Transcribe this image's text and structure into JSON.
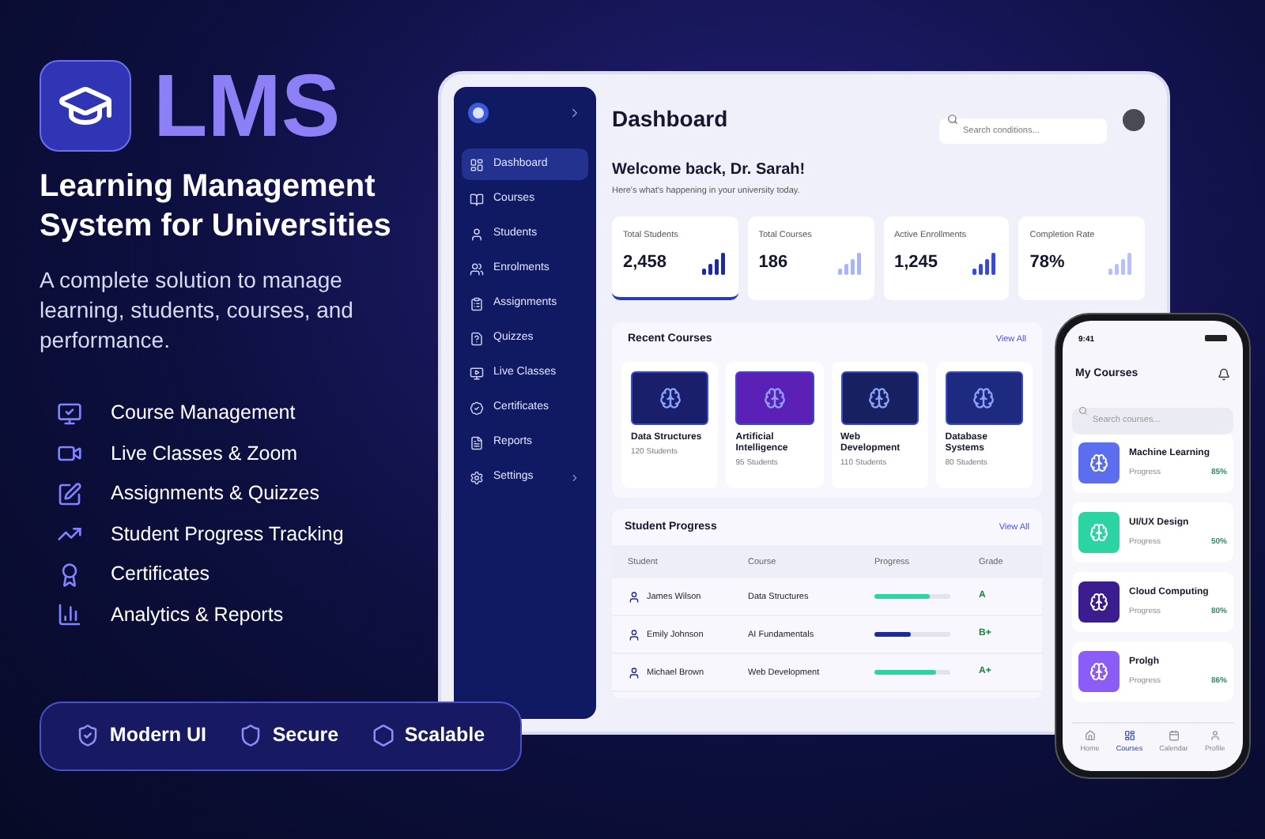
{
  "brand": {
    "logo_text": "LMS",
    "headline": "Learning Management System for Universities",
    "description": "A complete solution to manage learning, students, courses, and performance."
  },
  "features": [
    {
      "kind": "course",
      "label": "Course Management"
    },
    {
      "kind": "video",
      "label": "Live Classes & Zoom"
    },
    {
      "kind": "edit",
      "label": "Assignments & Quizzes"
    },
    {
      "kind": "progress",
      "label": "Student Progress Tracking"
    },
    {
      "kind": "certificate",
      "label": "Certificates"
    },
    {
      "kind": "analytics",
      "label": "Analytics & Reports"
    }
  ],
  "badges": [
    {
      "kind": "modern",
      "label": "Modern UI"
    },
    {
      "kind": "secure",
      "label": "Secure"
    },
    {
      "kind": "scalable",
      "label": "Scalable"
    }
  ],
  "sidebar": {
    "items": [
      {
        "kind": "dashboard",
        "label": "Dashboard",
        "selected": true,
        "has_submenu": false
      },
      {
        "kind": "courses",
        "label": "Courses",
        "selected": false,
        "has_submenu": false
      },
      {
        "kind": "students",
        "label": "Students",
        "selected": false,
        "has_submenu": false
      },
      {
        "kind": "enrollments",
        "label": "Enrolments",
        "selected": false,
        "has_submenu": false
      },
      {
        "kind": "assignments",
        "label": "Assignments",
        "selected": false,
        "has_submenu": false
      },
      {
        "kind": "quizzes",
        "label": "Quizzes",
        "selected": false,
        "has_submenu": false
      },
      {
        "kind": "live",
        "label": "Live Classes",
        "selected": false,
        "has_submenu": false
      },
      {
        "kind": "certificates",
        "label": "Certificates",
        "selected": false,
        "has_submenu": false
      },
      {
        "kind": "reports",
        "label": "Reports",
        "selected": false,
        "has_submenu": false
      },
      {
        "kind": "settings",
        "label": "Settings",
        "selected": false,
        "has_submenu": true
      }
    ]
  },
  "dashboard": {
    "title": "Dashboard",
    "search": {
      "placeholder": "Search conditions..."
    },
    "welcome": "Welcome back, Dr. Sarah!",
    "subtitle": "Here's what's happening in your university today.",
    "stats": [
      {
        "label": "Total Students",
        "value": "2,458",
        "selected": true,
        "color": "#1e2a9c"
      },
      {
        "label": "Total Courses",
        "value": "186",
        "selected": false,
        "color": "#a9b4f5"
      },
      {
        "label": "Active Enrollments",
        "value": "1,245",
        "selected": false,
        "color": "#3a4bd0"
      },
      {
        "label": "Completion Rate",
        "value": "78%",
        "selected": false,
        "color": "#b8c1f7"
      }
    ],
    "recent_courses": {
      "title": "Recent Courses",
      "view_all": "View All",
      "courses": [
        {
          "name": "Data Structures",
          "students": "120 Students",
          "color": "#1a1f6b"
        },
        {
          "name": "Artificial Intelligence",
          "students": "95 Students",
          "color": "#5b21b6"
        },
        {
          "name": "Web Development",
          "students": "110 Students",
          "color": "#172060"
        },
        {
          "name": "Database Systems",
          "students": "80 Students",
          "color": "#1e2a80"
        }
      ]
    },
    "student_progress": {
      "title": "Student Progress",
      "view_all": "View All",
      "columns": [
        "Student",
        "Course",
        "Progress",
        "Grade"
      ],
      "rows": [
        {
          "name": "James Wilson",
          "course": "Data Structures",
          "level": 0.72,
          "color": "#2dd4a3",
          "grade": "A"
        },
        {
          "name": "Emily Johnson",
          "course": "AI Fundamentals",
          "level": 0.48,
          "color": "#1e2a9c",
          "grade": "B+"
        },
        {
          "name": "Michael Brown",
          "course": "Web Development",
          "level": 0.82,
          "color": "#2dd4a3",
          "grade": "A+"
        }
      ]
    }
  },
  "phone": {
    "time": "9:41",
    "title": "My Courses",
    "search": {
      "placeholder": "Search courses..."
    },
    "courses": [
      {
        "name": "Machine Learning",
        "progress_label": "Progress",
        "percent": "85%",
        "color": "#5b6ef0"
      },
      {
        "name": "UI/UX Design",
        "progress_label": "Progress",
        "percent": "50%",
        "color": "#2dd4a3"
      },
      {
        "name": "Cloud Computing",
        "progress_label": "Progress",
        "percent": "80%",
        "color": "#3b1d8f"
      },
      {
        "name": "Prolgh",
        "progress_label": "Progress",
        "percent": "86%",
        "color": "#8b5cf6"
      }
    ],
    "nav": [
      {
        "kind": "home",
        "label": "Home",
        "selected": false
      },
      {
        "kind": "courses",
        "label": "Courses",
        "selected": true
      },
      {
        "kind": "calendar",
        "label": "Calendar",
        "selected": false
      },
      {
        "kind": "profile",
        "label": "Profile",
        "selected": false
      }
    ]
  }
}
